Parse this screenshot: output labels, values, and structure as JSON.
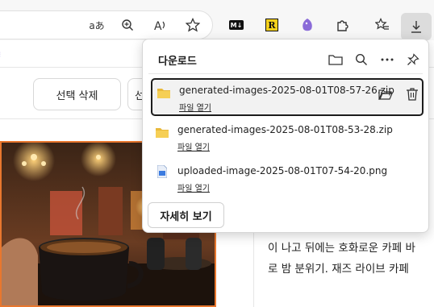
{
  "toolbar": {
    "read_aloud_glyph": "aあ",
    "icons": [
      "translate-icon",
      "zoom-icon",
      "read-aloud-icon",
      "favorite-star-icon",
      "markdown-extension-icon",
      "r-extension-icon",
      "bird-extension-icon",
      "extensions-icon",
      "favorites-icon",
      "downloads-icon"
    ],
    "markdown_ext_label": "M↓",
    "r_ext_label": "R"
  },
  "page": {
    "delete_selected_label": "선택 삭제",
    "second_button_partial": "선",
    "body_lines": [
      "이 나고 뒤에는 호화로운 카페 바",
      "로 밤 분위기. 재즈 라이브 카페"
    ],
    "accent_color": "#e8772e"
  },
  "downloads": {
    "title": "다운로드",
    "header_icons": [
      "folder-icon",
      "search-icon",
      "more-icon",
      "pin-icon"
    ],
    "items": [
      {
        "name": "generated-images-2025-08-01T08-57-26.zip",
        "link": "파일 열기",
        "type": "zip"
      },
      {
        "name": "generated-images-2025-08-01T08-53-28.zip",
        "link": "파일 열기",
        "type": "zip"
      },
      {
        "name": "uploaded-image-2025-08-01T07-54-20.png",
        "link": "파일 열기",
        "type": "png"
      }
    ],
    "detail_button_label": "자세히 보기"
  }
}
